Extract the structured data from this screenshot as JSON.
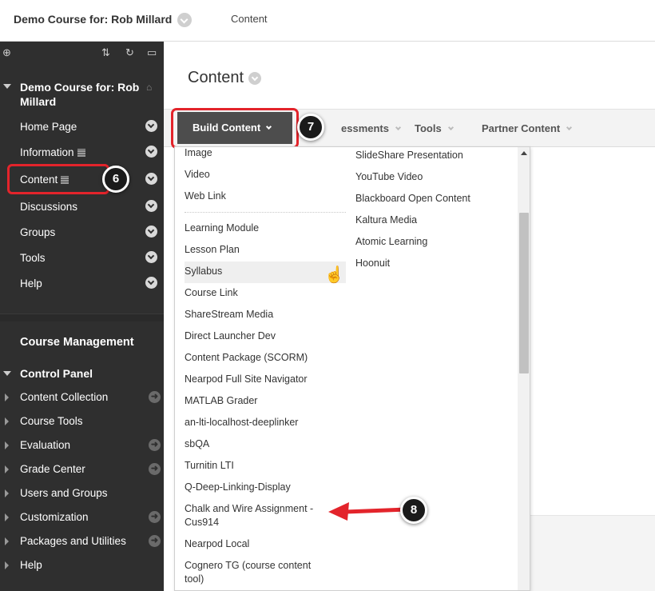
{
  "topbar": {
    "course_title": "Demo Course for: Rob Millard",
    "crumb": "Content"
  },
  "sidebar": {
    "course_title": "Demo Course for: Rob Millard",
    "items": [
      {
        "label": "Home Page"
      },
      {
        "label": "Information"
      },
      {
        "label": "Content"
      },
      {
        "label": "Discussions"
      },
      {
        "label": "Groups"
      },
      {
        "label": "Tools"
      },
      {
        "label": "Help"
      }
    ],
    "management_title": "Course Management",
    "control_panel_title": "Control Panel",
    "control_panel_items": [
      {
        "label": "Content Collection"
      },
      {
        "label": "Course Tools"
      },
      {
        "label": "Evaluation"
      },
      {
        "label": "Grade Center"
      },
      {
        "label": "Users and Groups"
      },
      {
        "label": "Customization"
      },
      {
        "label": "Packages and Utilities"
      },
      {
        "label": "Help"
      }
    ]
  },
  "main": {
    "title": "Content",
    "actionbar": {
      "build_content": "Build Content",
      "assessments": "essments",
      "tools": "Tools",
      "partner_content": "Partner Content"
    }
  },
  "menu": {
    "col1": [
      "Image",
      "Video",
      "Web Link",
      "Learning Module",
      "Lesson Plan",
      "Syllabus",
      "Course Link",
      "ShareStream Media",
      "Direct Launcher Dev",
      "Content Package (SCORM)",
      "Nearpod Full Site Navigator",
      "MATLAB Grader",
      "an-lti-localhost-deeplinker",
      "sbQA",
      "Turnitin LTI",
      "Q-Deep-Linking-Display",
      "Chalk and Wire Assignment - Cus914",
      "Nearpod Local",
      "Cognero TG (course content tool)"
    ],
    "col2": [
      "SlideShare Presentation",
      "YouTube Video",
      "Blackboard Open Content",
      "Kaltura Media",
      "Atomic Learning",
      "Hoonuit"
    ]
  },
  "badges": {
    "b6": "6",
    "b7": "7",
    "b8": "8"
  },
  "colors": {
    "highlight": "#e3242b",
    "sidebar": "#2f2f2f",
    "button": "#4d4d4d"
  }
}
